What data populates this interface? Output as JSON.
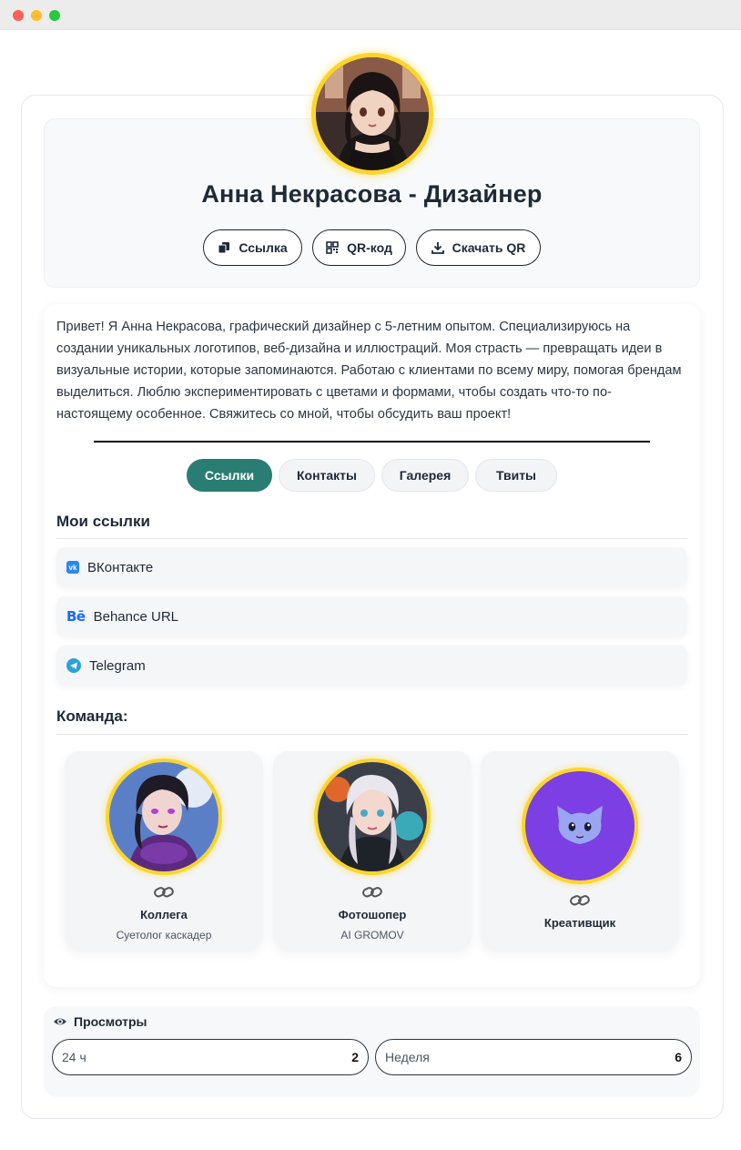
{
  "window": {
    "buttons": [
      "close",
      "minimize",
      "maximize"
    ]
  },
  "profile": {
    "name": "Анна Некрасова - Дизайнер",
    "avatar_icon": "avatar-anime-girl"
  },
  "actions": [
    {
      "label": "Ссылка",
      "icon": "copy-icon"
    },
    {
      "label": "QR-код",
      "icon": "qr-icon"
    },
    {
      "label": "Скачать QR",
      "icon": "download-icon"
    }
  ],
  "bio": "Привет! Я Анна Некрасова, графический дизайнер с 5-летним опытом. Специализируюсь на создании уникальных логотипов, веб-дизайна и иллюстраций. Моя страсть — превращать идеи в визуальные истории, которые запоминаются. Работаю с клиентами по всему миру, помогая брендам выделиться. Люблю экспериментировать с цветами и формами, чтобы создать что-то по-настоящему особенное. Свяжитесь со мной, чтобы обсудить ваш проект!",
  "tabs": [
    {
      "label": "Ссылки",
      "active": true
    },
    {
      "label": "Контакты",
      "active": false
    },
    {
      "label": "Галерея",
      "active": false
    },
    {
      "label": "Твиты",
      "active": false
    }
  ],
  "links_section": {
    "title": "Мои ссылки",
    "items": [
      {
        "label": "ВКонтакте",
        "icon": "vk-icon"
      },
      {
        "label": "Behance URL",
        "icon": "behance-icon"
      },
      {
        "label": "Telegram",
        "icon": "telegram-icon"
      }
    ]
  },
  "team_section": {
    "title": "Команда:",
    "members": [
      {
        "name": "Коллега",
        "subtitle": "Суетолог каскадер",
        "icon": "link-icon"
      },
      {
        "name": "Фотошопер",
        "subtitle": "AI GROMOV",
        "icon": "link-icon"
      },
      {
        "name": "Креативщик",
        "subtitle": "",
        "icon": "link-icon"
      }
    ]
  },
  "views": {
    "title": "Просмотры",
    "icon": "eye-icon",
    "stats": [
      {
        "label": "24 ч",
        "count": "2"
      },
      {
        "label": "Неделя",
        "count": "6"
      }
    ]
  },
  "colors": {
    "accent": "#2a7d72",
    "avatar_ring": "#fdd52a",
    "purple_avatar": "#7b3fe4"
  }
}
